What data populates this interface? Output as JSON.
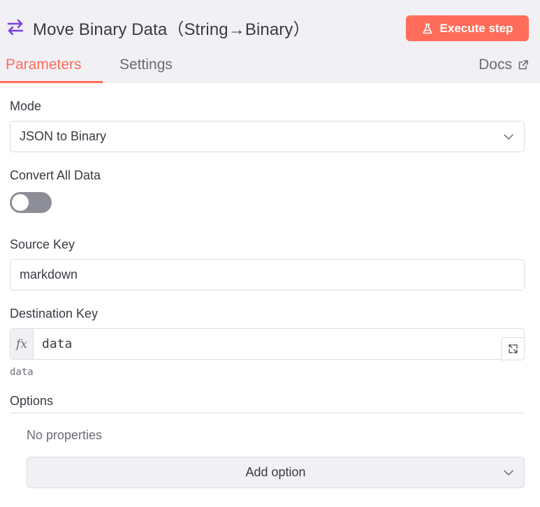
{
  "header": {
    "node_title": "Move Binary Data（String→Binary）",
    "node_icon": "swap-arrows-icon",
    "execute_label": "Execute step",
    "execute_icon": "flask-icon"
  },
  "tabs": [
    {
      "label": "Parameters",
      "active": true
    },
    {
      "label": "Settings",
      "active": false
    }
  ],
  "docs": {
    "label": "Docs",
    "icon": "external-link-icon"
  },
  "parameters": {
    "mode": {
      "label": "Mode",
      "value": "JSON to Binary"
    },
    "convert_all": {
      "label": "Convert All Data",
      "enabled": false
    },
    "source_key": {
      "label": "Source Key",
      "value": "markdown"
    },
    "destination_key": {
      "label": "Destination Key",
      "fx": "fx",
      "value": "data",
      "hint": "data"
    },
    "options": {
      "label": "Options",
      "empty_text": "No properties",
      "add_label": "Add option"
    }
  },
  "colors": {
    "accent": "#ff6d5a",
    "node_icon": "#7b3fe4",
    "header_bg": "#f0f0f5",
    "toggle_off": "#8e8e99"
  }
}
